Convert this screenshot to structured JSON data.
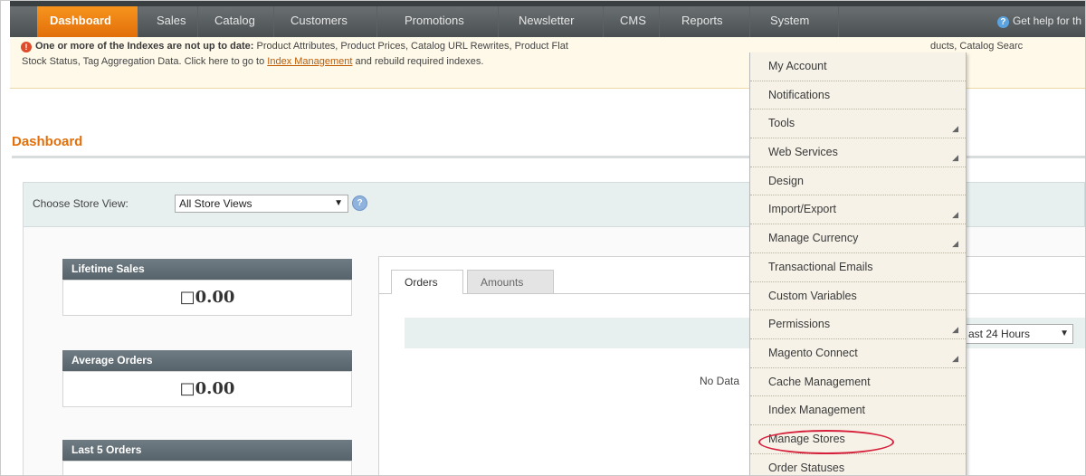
{
  "nav": {
    "items": [
      "Dashboard",
      "Sales",
      "Catalog",
      "Customers",
      "Promotions",
      "Newsletter",
      "CMS",
      "Reports",
      "System"
    ],
    "help": "Get help for th"
  },
  "notice": {
    "title": "One or more of the Indexes are not up to date:",
    "line1": "Product Attributes, Product Prices, Catalog URL Rewrites, Product Flat",
    "line1_tail": "ducts, Catalog Searc",
    "line2_pre": "Stock Status, Tag Aggregation Data. Click here to go to",
    "link": "Index Management",
    "line2_post": "and rebuild required indexes."
  },
  "page": {
    "title": "Dashboard"
  },
  "store_switcher": {
    "label": "Choose Store View:",
    "value": "All Store Views"
  },
  "boxes": {
    "lifetime_label": "Lifetime Sales",
    "lifetime_value": "□0.00",
    "average_label": "Average Orders",
    "average_value": "□0.00",
    "last5_label": "Last 5 Orders"
  },
  "tabs": [
    "Orders",
    "Amounts"
  ],
  "chart": {
    "period": "ast 24 Hours",
    "no_data": "No Data"
  },
  "system_menu": {
    "items": [
      {
        "label": "My Account"
      },
      {
        "label": "Notifications"
      },
      {
        "label": "Tools"
      },
      {
        "label": "Web Services"
      },
      {
        "label": "Design"
      },
      {
        "label": "Import/Export"
      },
      {
        "label": "Manage Currency"
      },
      {
        "label": "Transactional Emails"
      },
      {
        "label": "Custom Variables"
      },
      {
        "label": "Permissions"
      },
      {
        "label": "Magento Connect"
      },
      {
        "label": "Cache Management"
      },
      {
        "label": "Index Management"
      },
      {
        "label": "Manage Stores"
      },
      {
        "label": "Order Statuses"
      }
    ]
  },
  "colors": {
    "accent": "#e26f0a",
    "highlight": "#d6203b"
  }
}
